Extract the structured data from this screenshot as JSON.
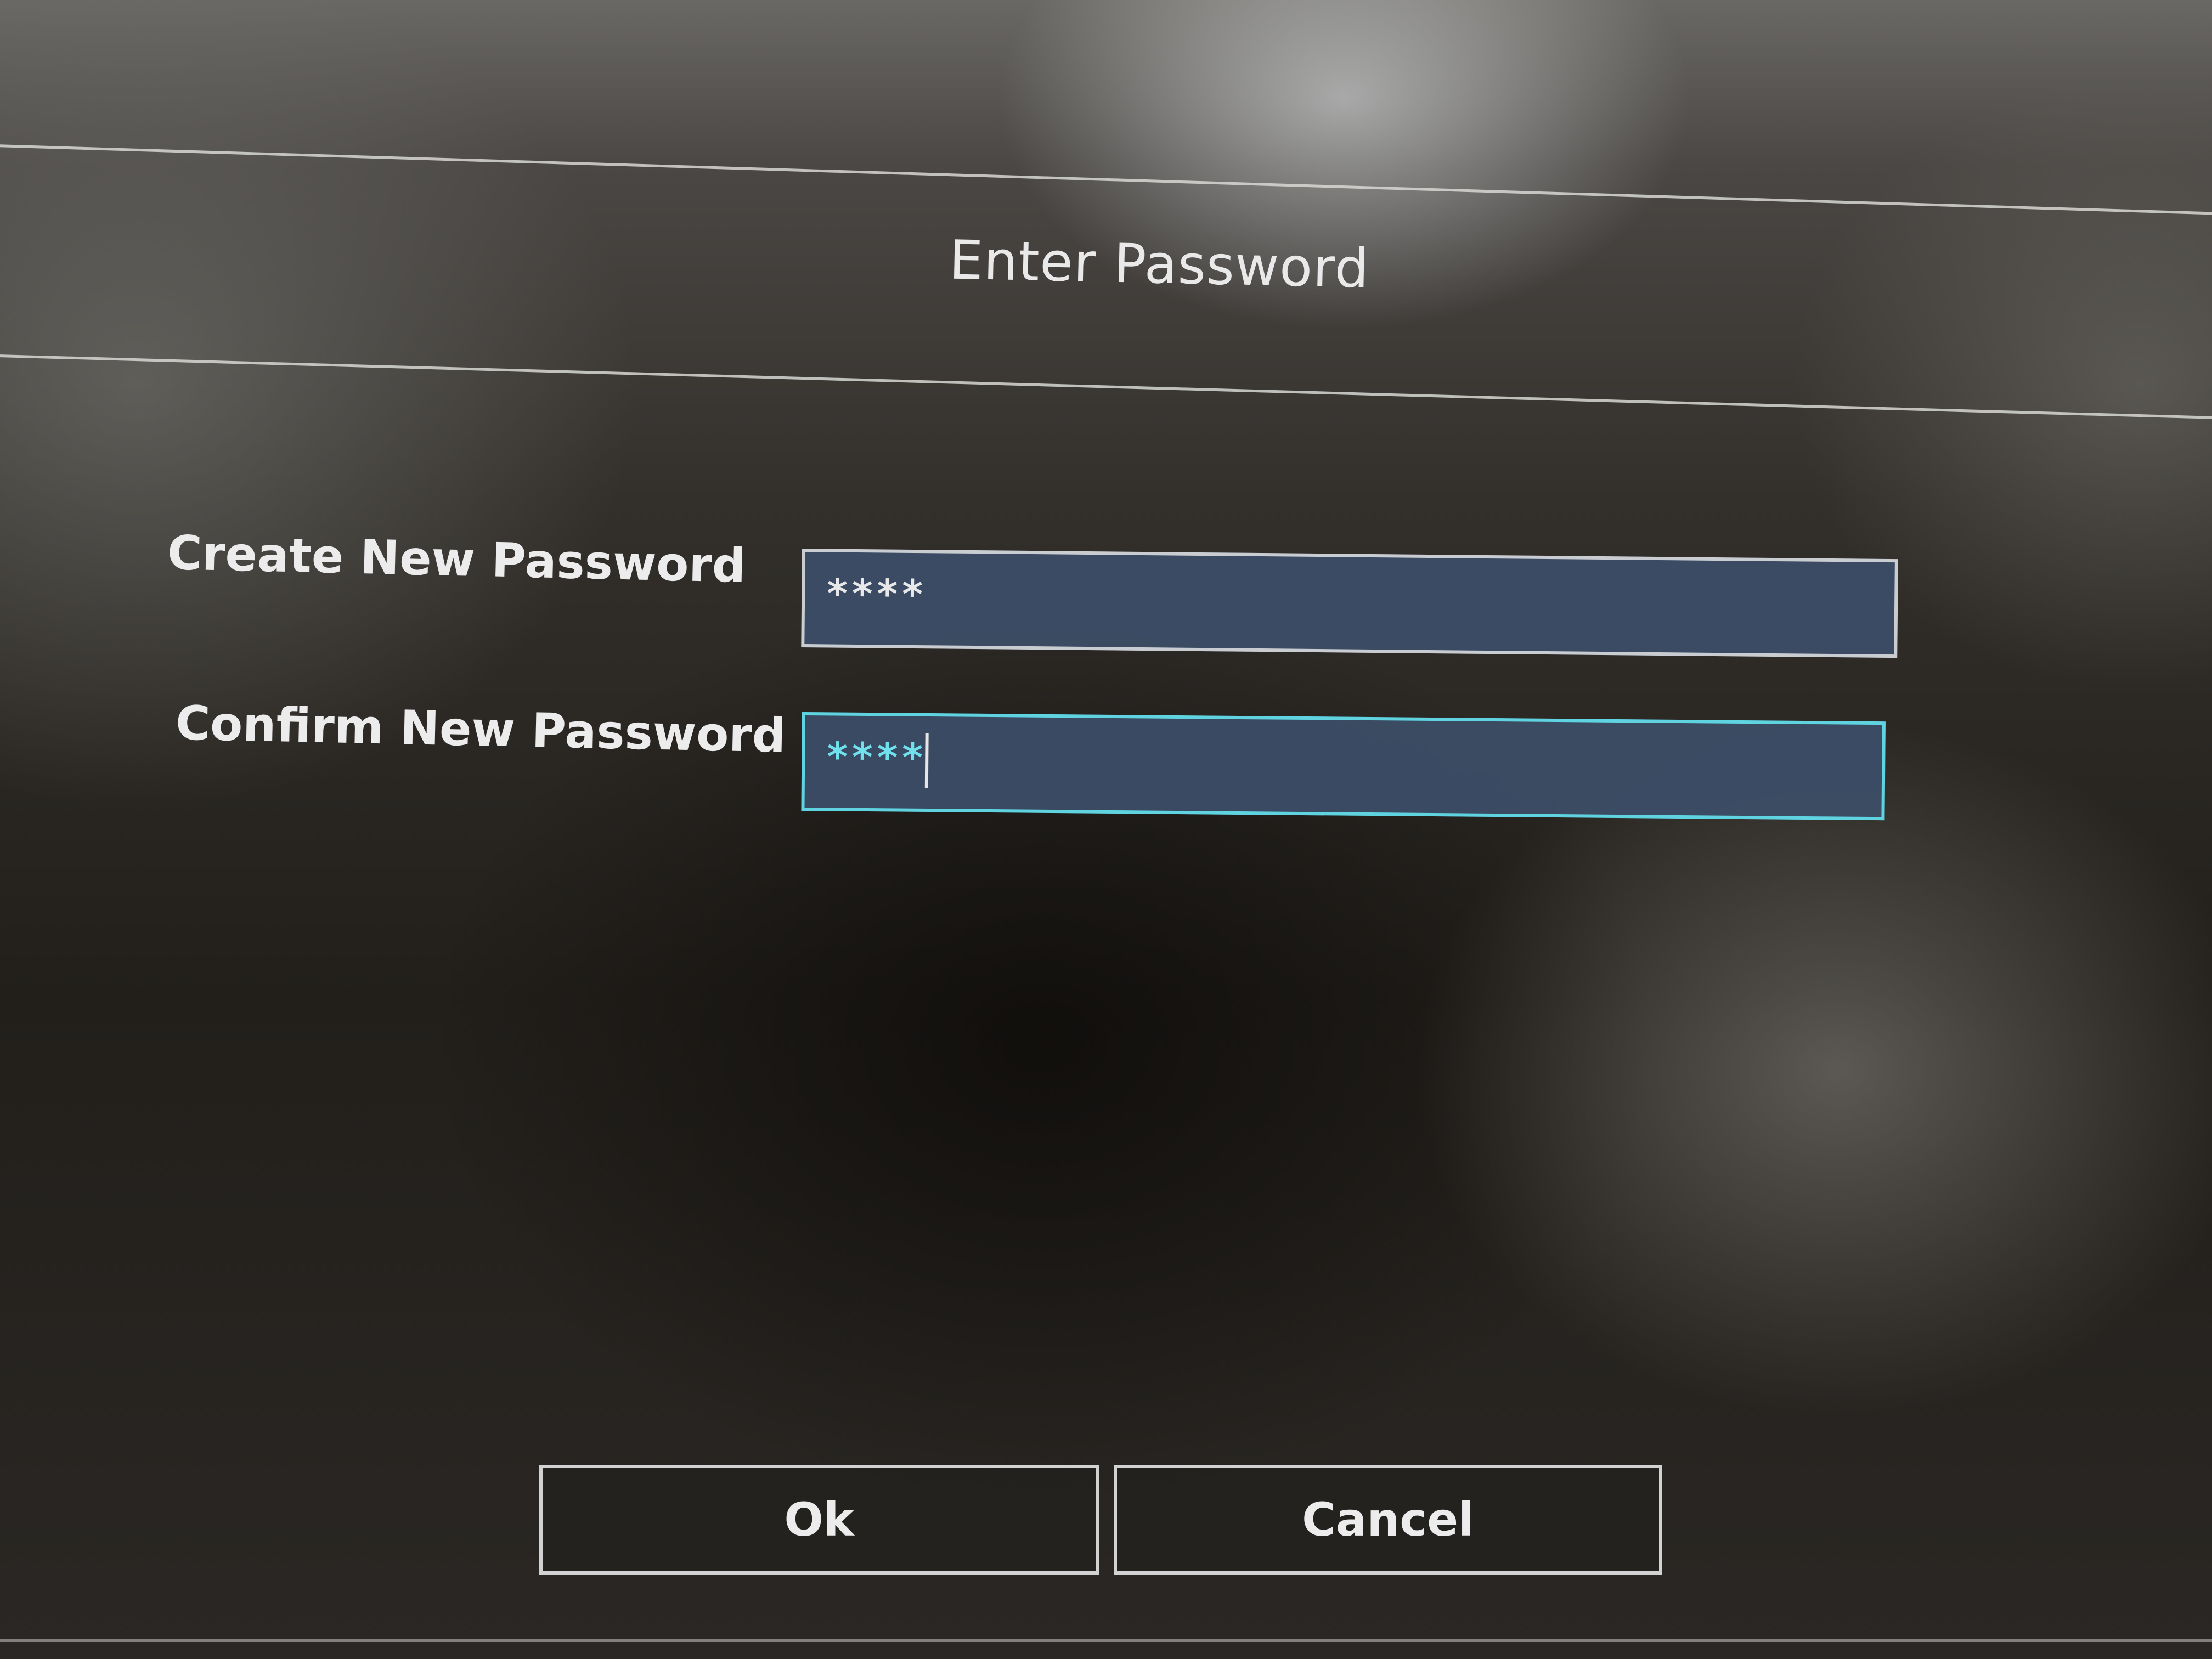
{
  "dialog": {
    "title": "Enter Password"
  },
  "form": {
    "create_label": "Create New Password",
    "create_value": "****",
    "confirm_label": "Confirm New Password",
    "confirm_value": "****"
  },
  "buttons": {
    "ok_label": "Ok",
    "cancel_label": "Cancel"
  },
  "colors": {
    "field_background": "#3c4e68",
    "focus_border": "#5fd3df",
    "text": "#ececec"
  }
}
